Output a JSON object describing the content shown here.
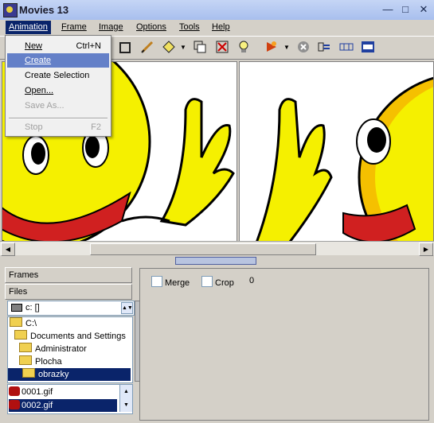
{
  "window": {
    "title": "Movies 13"
  },
  "menubar": {
    "items": [
      "Animation",
      "Frame",
      "Image",
      "Options",
      "Tools",
      "Help"
    ]
  },
  "animation_menu": {
    "items": [
      {
        "label": "New",
        "shortcut": "Ctrl+N",
        "state": "normal"
      },
      {
        "label": "Create",
        "shortcut": "",
        "state": "highlighted"
      },
      {
        "label": "Create Selection",
        "shortcut": "",
        "state": "normal"
      },
      {
        "label": "Open...",
        "shortcut": "",
        "state": "normal"
      },
      {
        "label": "Save As...",
        "shortcut": "",
        "state": "disabled"
      },
      {
        "label": "Stop",
        "shortcut": "F2",
        "state": "disabled"
      }
    ]
  },
  "left_panel": {
    "frames_label": "Frames",
    "files_label": "Files",
    "drive": "c: []",
    "folders": [
      "C:\\",
      "Documents and Settings",
      "Administrator",
      "Plocha",
      "obrazky"
    ],
    "selected_folder": "obrazky",
    "files": [
      "0001.gif",
      "0002.gif"
    ],
    "selected_file": "0002.gif"
  },
  "options_panel": {
    "merge_label": "Merge",
    "merge_checked": false,
    "crop_label": "Crop",
    "crop_checked": false,
    "value": "0"
  },
  "colors": {
    "accent": "#0a246a",
    "menu_highlight": "#6480c8",
    "smiley_yellow": "#f5f000"
  }
}
